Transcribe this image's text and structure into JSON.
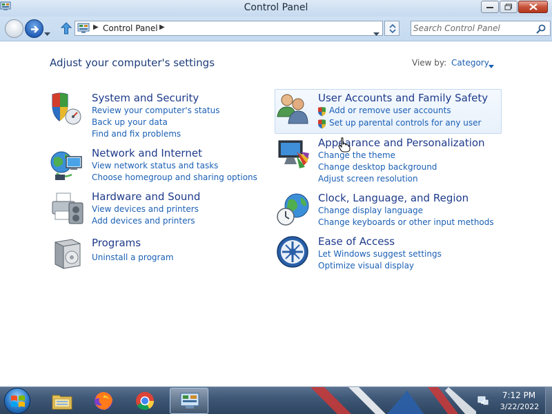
{
  "window": {
    "title": "Control Panel"
  },
  "address": {
    "breadcrumb": "Control Panel",
    "search_placeholder": "Search Control Panel"
  },
  "main": {
    "heading": "Adjust your computer's settings",
    "view_by_label": "View by:",
    "view_by_value": "Category"
  },
  "categories": [
    {
      "title": "System and Security",
      "links": [
        "Review your computer's status",
        "Back up your data",
        "Find and fix problems"
      ]
    },
    {
      "title": "Network and Internet",
      "links": [
        "View network status and tasks",
        "Choose homegroup and sharing options"
      ]
    },
    {
      "title": "Hardware and Sound",
      "links": [
        "View devices and printers",
        "Add devices and printers"
      ]
    },
    {
      "title": "Programs",
      "links": [
        "Uninstall a program"
      ]
    },
    {
      "title": "User Accounts and Family Safety",
      "links": [
        "Add or remove user accounts",
        "Set up parental controls for any user"
      ]
    },
    {
      "title": "Appearance and Personalization",
      "links": [
        "Change the theme",
        "Change desktop background",
        "Adjust screen resolution"
      ]
    },
    {
      "title": "Clock, Language, and Region",
      "links": [
        "Change display language",
        "Change keyboards or other input methods"
      ]
    },
    {
      "title": "Ease of Access",
      "links": [
        "Let Windows suggest settings",
        "Optimize visual display"
      ]
    }
  ],
  "taskbar": {
    "time": "7:12 PM",
    "date": "3/22/2022",
    "items": [
      "file-explorer-icon",
      "firefox-icon",
      "chrome-icon",
      "control-panel-icon"
    ]
  },
  "colors": {
    "link": "#1a5fb4",
    "category_title": "#1e3a8a",
    "heading": "#1e3c7a"
  }
}
